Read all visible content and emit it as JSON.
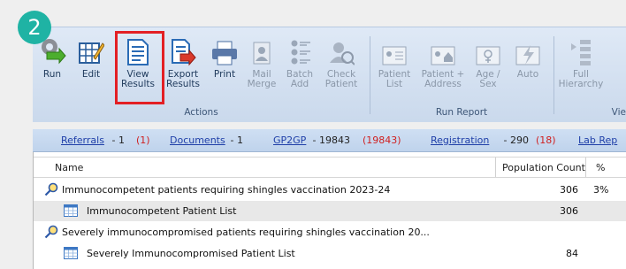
{
  "step_badge": "2",
  "colors": {
    "highlight": "#e31f24",
    "badge": "#1fb3a4",
    "link": "#1f3fa8",
    "red_count": "#d02020"
  },
  "ribbon": {
    "buttons": [
      {
        "label": "Run",
        "icon": "run-gear-icon"
      },
      {
        "label": "Edit",
        "icon": "edit-grid-icon"
      },
      {
        "label": "View\nResults",
        "icon": "view-results-icon"
      },
      {
        "label": "Export\nResults",
        "icon": "export-results-icon"
      },
      {
        "label": "Print",
        "icon": "printer-icon"
      },
      {
        "label": "Mail\nMerge",
        "icon": "mail-merge-icon"
      },
      {
        "label": "Batch\nAdd",
        "icon": "batch-add-icon"
      },
      {
        "label": "Check\nPatient",
        "icon": "check-patient-icon"
      },
      {
        "label": "Patient\nList",
        "icon": "patient-list-icon"
      },
      {
        "label": "Patient +\nAddress",
        "icon": "patient-address-icon"
      },
      {
        "label": "Age /\nSex",
        "icon": "age-sex-icon"
      },
      {
        "label": "Auto",
        "icon": "auto-icon"
      },
      {
        "label": "Full\nHierarchy",
        "icon": "full-hierarchy-icon"
      }
    ],
    "groups": [
      "Actions",
      "Run Report",
      "Vie"
    ]
  },
  "linkbar": {
    "referrals": "Referrals",
    "referrals_count": " - 1 ",
    "referrals_red": "(1)",
    "documents": "Documents",
    "documents_count": " - 1",
    "gp2gp": "GP2GP",
    "gp2gp_count": " - 19843 ",
    "gp2gp_red": "(19843)",
    "registration": "Registration",
    "registration_count": " - 290 ",
    "registration_red": "(18)",
    "lab": "Lab Rep"
  },
  "grid": {
    "headers": {
      "name": "Name",
      "population": "Population Count",
      "percent": "%"
    },
    "rows": [
      {
        "name": "Immunocompetent patients requiring shingles vaccination 2023-24",
        "count": "306",
        "percent": "3%"
      },
      {
        "name": "Immunocompetent Patient List",
        "count": "306",
        "percent": ""
      },
      {
        "name": "Severely immunocompromised patients requiring shingles vaccination 20...",
        "count": "",
        "percent": ""
      },
      {
        "name": "Severely Immunocompromised Patient List",
        "count": "84",
        "percent": ""
      }
    ]
  }
}
